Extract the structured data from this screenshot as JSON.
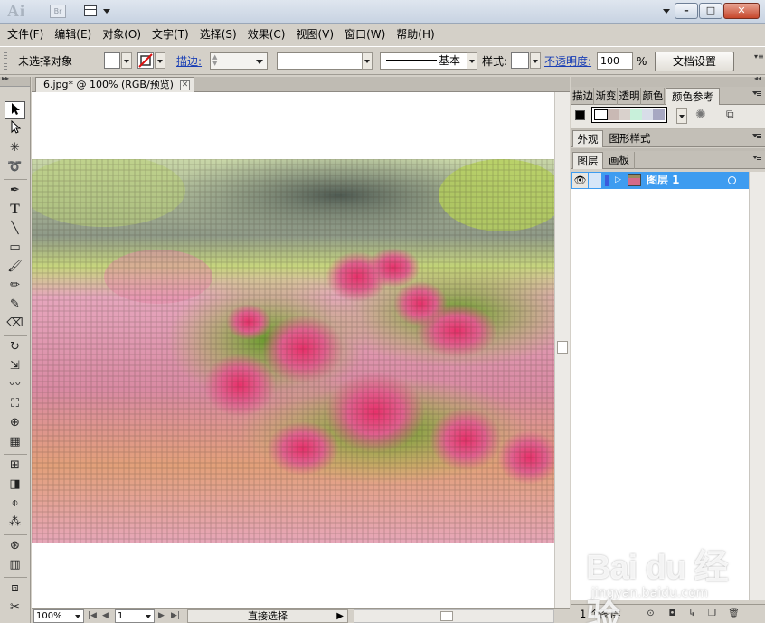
{
  "app": {
    "logo": "Ai",
    "bridge_label": "Br",
    "window_buttons": {
      "minimize": "–",
      "maximize": "□",
      "close": "✕"
    }
  },
  "menu": [
    "文件(F)",
    "编辑(E)",
    "对象(O)",
    "文字(T)",
    "选择(S)",
    "效果(C)",
    "视图(V)",
    "窗口(W)",
    "帮助(H)"
  ],
  "control": {
    "selection_status": "未选择对象",
    "stroke_label": "描边:",
    "stroke_profile": "基本",
    "style_label": "样式:",
    "opacity_label": "不透明度:",
    "opacity_value": "100",
    "opacity_unit": "%",
    "doc_setup_button": "文档设置"
  },
  "document": {
    "tab_title": "6.jpg* @ 100% (RGB/预览)",
    "zoom": "100%",
    "artboard_number": "1",
    "status_tool": "直接选择"
  },
  "panels": {
    "top_tabs": [
      "描边",
      "渐变",
      "透明",
      "颜色",
      "颜色参考"
    ],
    "active_top_tab": "颜色参考",
    "appearance_tabs": [
      "外观",
      "图形样式"
    ],
    "layers_tabs": [
      "图层",
      "画板"
    ],
    "color_guide_swatches": [
      "#ffffff",
      "#c9b9b4",
      "#d9d1cc",
      "#c8f0da",
      "#d8dde8",
      "#a7a8c2"
    ],
    "layer": {
      "name": "图层 1",
      "count_label": "1 个图层",
      "eye_icon": "eye-icon"
    }
  },
  "watermark": {
    "main": "Bai du 经验",
    "sub": "jingyan.baidu.com"
  }
}
